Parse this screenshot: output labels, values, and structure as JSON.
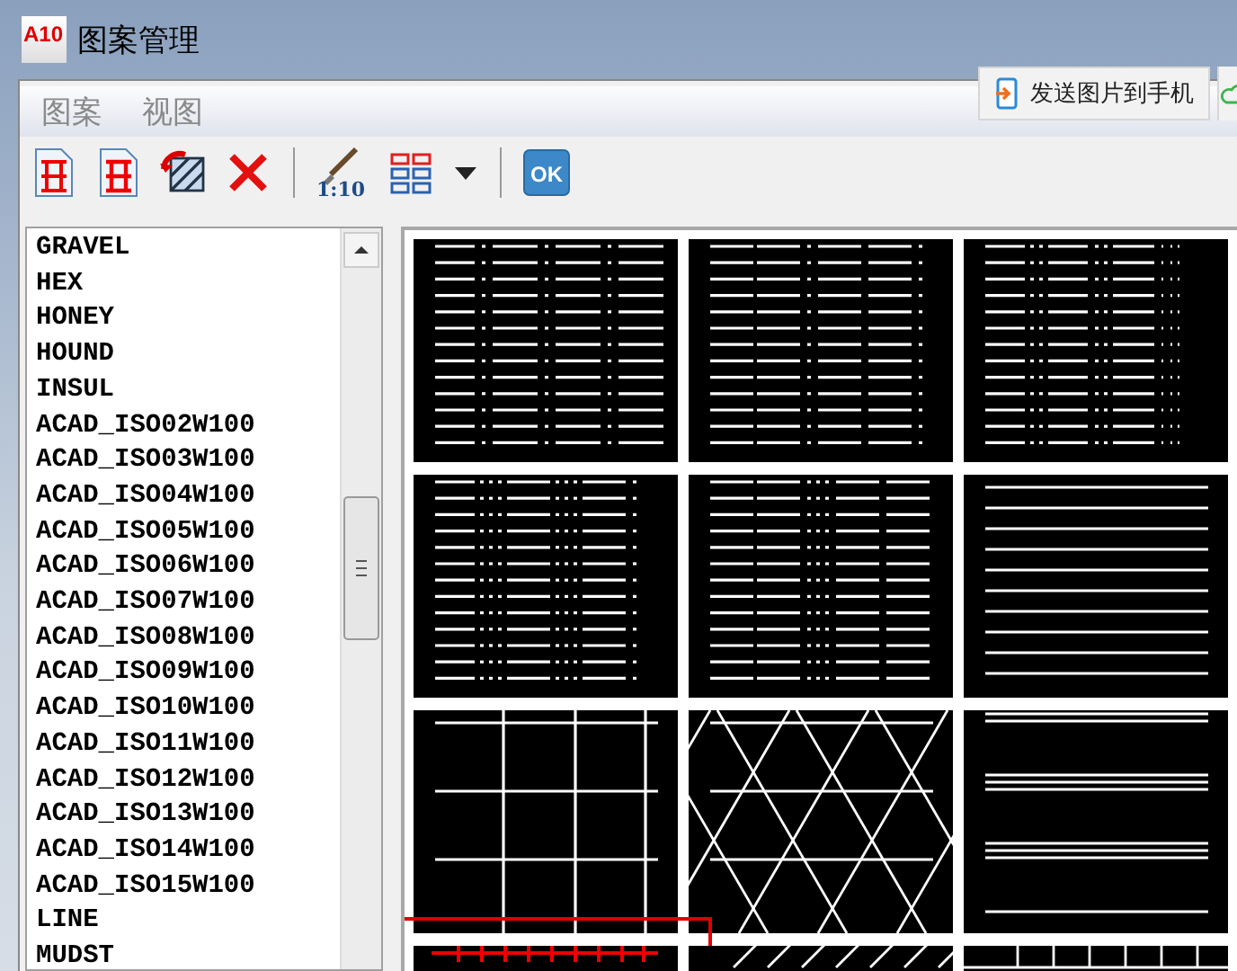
{
  "window": {
    "logo_text": "A10",
    "title": "图案管理"
  },
  "menu": [
    "图案",
    "视图"
  ],
  "send_button": {
    "label": "发送图片到手机"
  },
  "toolbar": {
    "scale_icon_text": "1:10",
    "ok_text": "OK"
  },
  "patterns_list": {
    "items": [
      {
        "label": "GRAVEL",
        "selected": false
      },
      {
        "label": "HEX",
        "selected": false
      },
      {
        "label": "HONEY",
        "selected": false
      },
      {
        "label": "HOUND",
        "selected": false
      },
      {
        "label": "INSUL",
        "selected": false
      },
      {
        "label": "ACAD_ISO02W100",
        "selected": false
      },
      {
        "label": "ACAD_ISO03W100",
        "selected": false
      },
      {
        "label": "ACAD_ISO04W100",
        "selected": false
      },
      {
        "label": "ACAD_ISO05W100",
        "selected": false
      },
      {
        "label": "ACAD_ISO06W100",
        "selected": false
      },
      {
        "label": "ACAD_ISO07W100",
        "selected": false
      },
      {
        "label": "ACAD_ISO08W100",
        "selected": false
      },
      {
        "label": "ACAD_ISO09W100",
        "selected": false
      },
      {
        "label": "ACAD_ISO10W100",
        "selected": false
      },
      {
        "label": "ACAD_ISO11W100",
        "selected": false
      },
      {
        "label": "ACAD_ISO12W100",
        "selected": false
      },
      {
        "label": "ACAD_ISO13W100",
        "selected": false
      },
      {
        "label": "ACAD_ISO14W100",
        "selected": false
      },
      {
        "label": "ACAD_ISO15W100",
        "selected": false
      },
      {
        "label": "LINE",
        "selected": false
      },
      {
        "label": "MUDST",
        "selected": false
      }
    ]
  },
  "previews": [
    {
      "kind": "dash-dot",
      "selected": false
    },
    {
      "kind": "dash-dash-dot",
      "selected": false
    },
    {
      "kind": "dash-double-dot",
      "selected": false
    },
    {
      "kind": "dash-triple-dot",
      "selected": false
    },
    {
      "kind": "dash-dash-triple-dot",
      "selected": false
    },
    {
      "kind": "lines",
      "selected": false
    },
    {
      "kind": "grid",
      "selected": false
    },
    {
      "kind": "triangles",
      "selected": false
    },
    {
      "kind": "line-groups",
      "selected": false
    },
    {
      "kind": "ticked-line",
      "selected": true
    },
    {
      "kind": "diagonal",
      "selected": false
    },
    {
      "kind": "brick",
      "selected": false
    }
  ]
}
